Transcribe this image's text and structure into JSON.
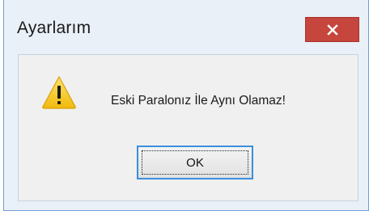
{
  "dialog": {
    "title": "Ayarlarım",
    "message": "Eski Paralonız İle Aynı Olamaz!",
    "ok_label": "OK",
    "icon": "warning-icon",
    "close_icon": "close-icon"
  },
  "colors": {
    "frame_border": "#6f9fd6",
    "title_bg": "#eaf0f7",
    "close_bg": "#c6453c",
    "client_bg": "#f0f0f0",
    "ok_border": "#3c8fdc",
    "warning_fill": "#f7c81c"
  }
}
